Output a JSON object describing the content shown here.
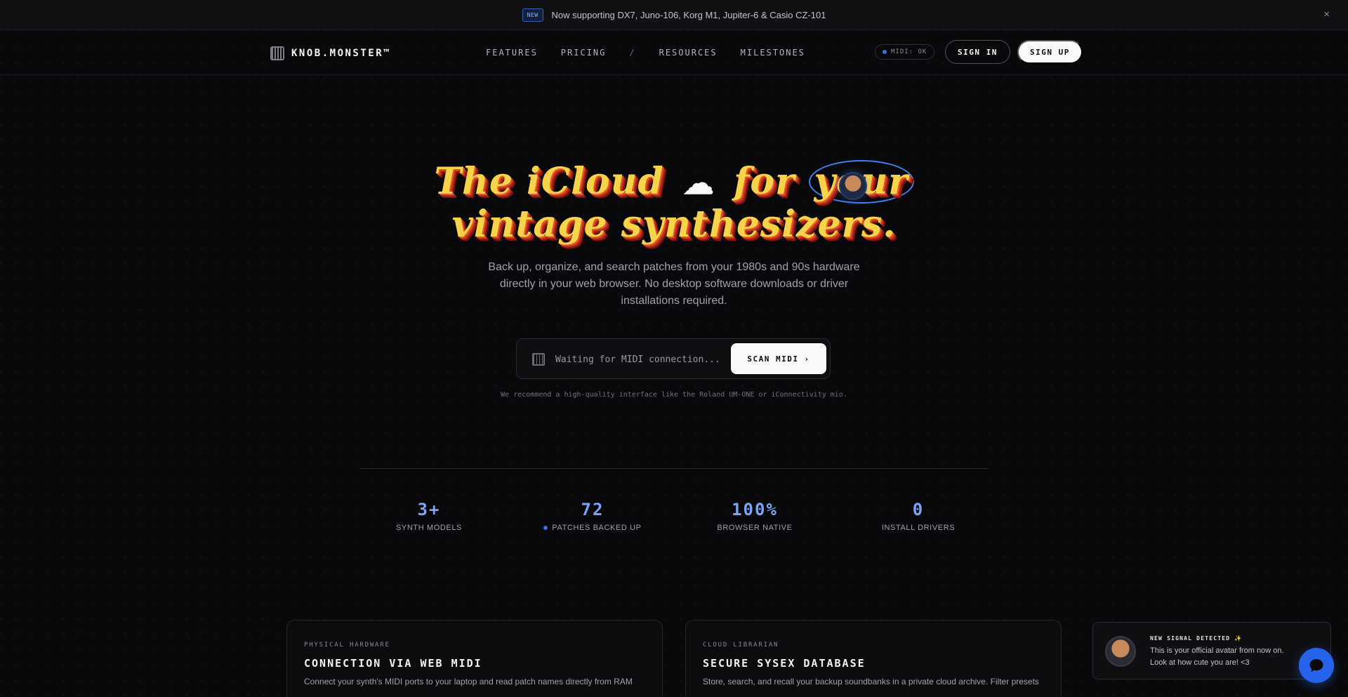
{
  "announcement": {
    "badge": "NEW",
    "text": "Now supporting DX7, Juno-106, Korg M1, Jupiter-6 & Casio CZ-101",
    "close_icon": "×"
  },
  "nav": {
    "logo_text": "KNOB.MONSTER™",
    "links": [
      "FEATURES",
      "PRICING",
      "/",
      "RESOURCES",
      "MILESTONES"
    ],
    "midi_status": "MIDI: OK",
    "signin_label": "SIGN IN",
    "signup_label": "SIGN UP"
  },
  "hero": {
    "title_line1_pre": "The iCloud",
    "cloud_icon": "☁",
    "title_line1_mid": "for",
    "title_line1_circled": "your",
    "title_line2": "vintage synthesizers.",
    "subtitle": "Back up, organize, and search patches from your 1980s and 90s hardware directly in your web browser. No desktop software downloads or driver installations required.",
    "scan_placeholder": "Waiting for MIDI connection...",
    "scan_button": "SCAN MIDI",
    "scan_chevron": "›",
    "recommendation": "We recommend a high-quality interface like the Roland UM-ONE or iConnectivity mio."
  },
  "stats": [
    {
      "value": "3+",
      "label": "SYNTH MODELS"
    },
    {
      "value": "72",
      "label": "PATCHES BACKED UP"
    },
    {
      "value": "100%",
      "label": "BROWSER NATIVE"
    },
    {
      "value": "0",
      "label": "INSTALL DRIVERS"
    }
  ],
  "features": [
    {
      "kicker": "PHYSICAL HARDWARE",
      "title": "CONNECTION VIA WEB MIDI",
      "description": "Connect your synth's MIDI ports to your laptop and read patch names directly from RAM"
    },
    {
      "kicker": "CLOUD LIBRARIAN",
      "title": "SECURE SYSEX DATABASE",
      "description": "Store, search, and recall your backup soundbanks in a private cloud archive. Filter presets"
    }
  ],
  "toast": {
    "title": "NEW SIGNAL DETECTED ✨",
    "line1": "This is your official avatar from now on.",
    "line2": "Look at how cute you are! <3"
  },
  "colors": {
    "accent": "#3b82f6",
    "stat_number": "#7aa2f7",
    "title_yellow": "#f7d34a",
    "title_red": "#b8271b"
  }
}
